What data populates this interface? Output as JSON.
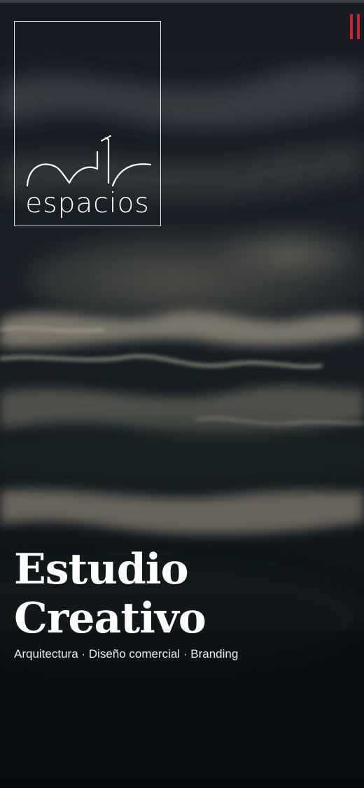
{
  "brand": {
    "logo_text": "espacios",
    "logo_icon": "roofline-mark-icon"
  },
  "menu": {
    "icon": "menu-toggle-icon",
    "color": "#c0262b"
  },
  "hero": {
    "title_line1": "Estudio",
    "title_line2": "Creativo",
    "subtitle": "Arquitectura · Diseño comercial · Branding",
    "background": "dark-water-ripples"
  },
  "colors": {
    "background": "#0b1014",
    "text": "#ffffff",
    "accent": "#c0262b"
  }
}
